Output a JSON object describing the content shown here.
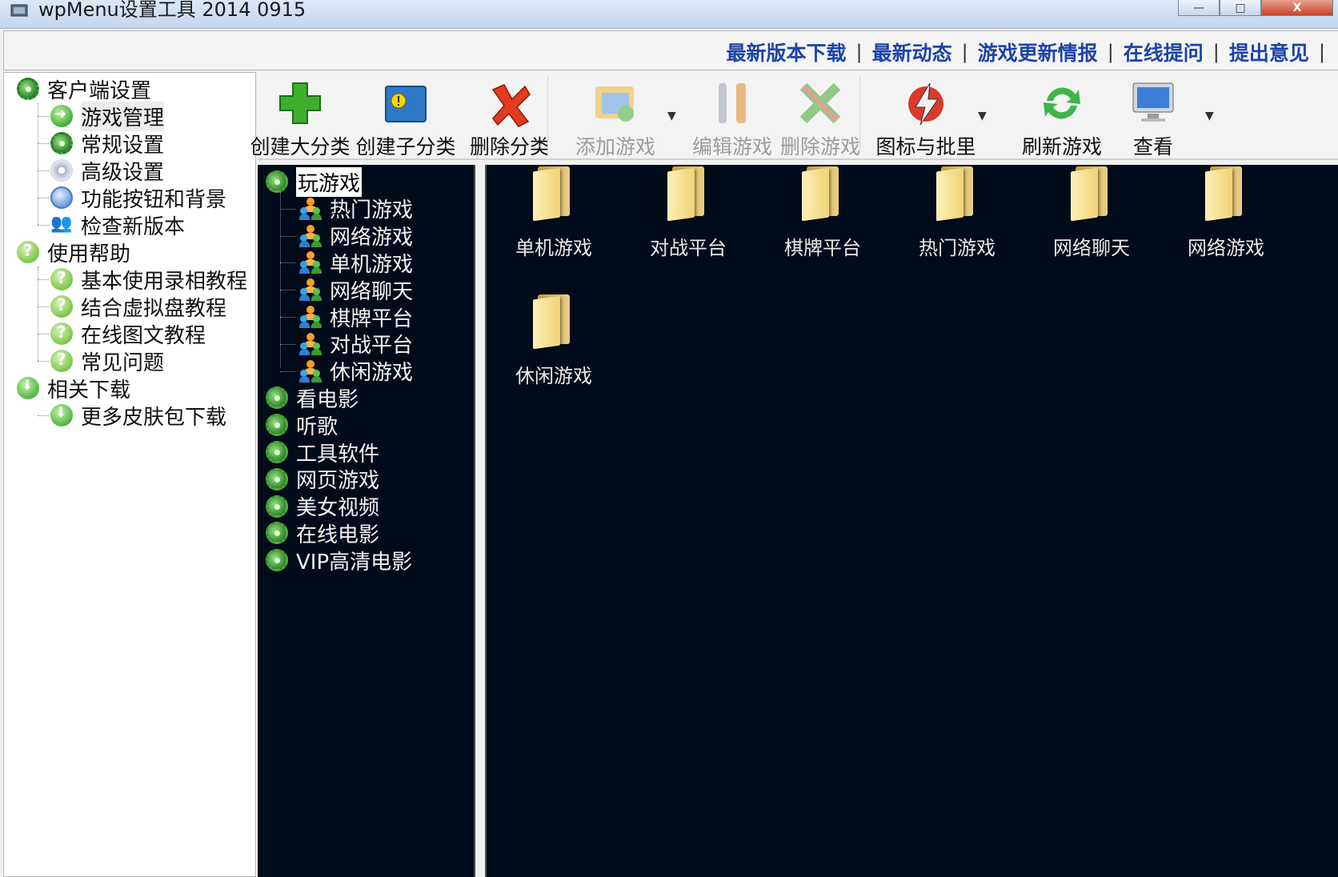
{
  "window": {
    "title": "wpMenu设置工具 2014 0915",
    "controls": {
      "minimize": "—",
      "maximize": "□",
      "close": "X"
    }
  },
  "links": [
    "最新版本下载",
    "最新动态",
    "游戏更新情报",
    "在线提问",
    "提出意见"
  ],
  "link_separator": "|",
  "left_nav": [
    {
      "label": "客户端设置",
      "icon": "gear-icon",
      "level": 0
    },
    {
      "label": "游戏管理",
      "icon": "arrow-right-icon",
      "level": 1,
      "selected": true
    },
    {
      "label": "常规设置",
      "icon": "gear-icon",
      "level": 1
    },
    {
      "label": "高级设置",
      "icon": "cd-icon",
      "level": 1
    },
    {
      "label": "功能按钮和背景",
      "icon": "circle-icon",
      "level": 1
    },
    {
      "label": "检查新版本",
      "icon": "people-icon",
      "level": 1
    },
    {
      "label": "使用帮助",
      "icon": "help-icon",
      "level": 0
    },
    {
      "label": "基本使用录相教程",
      "icon": "help-icon",
      "level": 1
    },
    {
      "label": "结合虚拟盘教程",
      "icon": "help-icon",
      "level": 1
    },
    {
      "label": "在线图文教程",
      "icon": "help-icon",
      "level": 1
    },
    {
      "label": "常见问题",
      "icon": "help-icon",
      "level": 1
    },
    {
      "label": "相关下载",
      "icon": "download-icon",
      "level": 0
    },
    {
      "label": "更多皮肤包下载",
      "icon": "download-icon",
      "level": 1
    }
  ],
  "toolbar": [
    {
      "label": "创建大分类",
      "icon": "plus-icon",
      "disabled": false
    },
    {
      "label": "创建子分类",
      "icon": "folder-warning-icon",
      "disabled": false
    },
    {
      "label": "删除分类",
      "icon": "x-icon",
      "disabled": false
    },
    {
      "label": "添加游戏",
      "icon": "add-game-icon",
      "disabled": true,
      "dropdown": true
    },
    {
      "label": "编辑游戏",
      "icon": "tools-icon",
      "disabled": true
    },
    {
      "label": "删除游戏",
      "icon": "delete-game-icon",
      "disabled": true
    },
    {
      "label": "图标与批里",
      "icon": "lightning-icon",
      "disabled": false,
      "dropdown": true
    },
    {
      "label": "刷新游戏",
      "icon": "refresh-icon",
      "disabled": false
    },
    {
      "label": "查看",
      "icon": "monitor-icon",
      "disabled": false,
      "dropdown": true
    }
  ],
  "tree": [
    {
      "label": "玩游戏",
      "icon": "gear-icon",
      "level": 0,
      "selected": true
    },
    {
      "label": "热门游戏",
      "icon": "people-icon",
      "level": 1
    },
    {
      "label": "网络游戏",
      "icon": "people-icon",
      "level": 1
    },
    {
      "label": "单机游戏",
      "icon": "people-icon",
      "level": 1
    },
    {
      "label": "网络聊天",
      "icon": "people-icon",
      "level": 1
    },
    {
      "label": "棋牌平台",
      "icon": "people-icon",
      "level": 1
    },
    {
      "label": "对战平台",
      "icon": "people-icon",
      "level": 1
    },
    {
      "label": "休闲游戏",
      "icon": "people-icon",
      "level": 1
    },
    {
      "label": "看电影",
      "icon": "gear-icon",
      "level": 0
    },
    {
      "label": "听歌",
      "icon": "gear-icon",
      "level": 0
    },
    {
      "label": "工具软件",
      "icon": "gear-icon",
      "level": 0
    },
    {
      "label": "网页游戏",
      "icon": "gear-icon",
      "level": 0
    },
    {
      "label": "美女视频",
      "icon": "gear-icon",
      "level": 0
    },
    {
      "label": "在线电影",
      "icon": "gear-icon",
      "level": 0
    },
    {
      "label": "VIP高清电影",
      "icon": "gear-icon",
      "level": 0
    }
  ],
  "folders": [
    "单机游戏",
    "对战平台",
    "棋牌平台",
    "热门游戏",
    "网络聊天",
    "网络游戏",
    "休闲游戏"
  ],
  "colors": {
    "panel_bg": "#020b1a",
    "link": "#1e44a8",
    "titlebar": "#c4d7ee"
  }
}
